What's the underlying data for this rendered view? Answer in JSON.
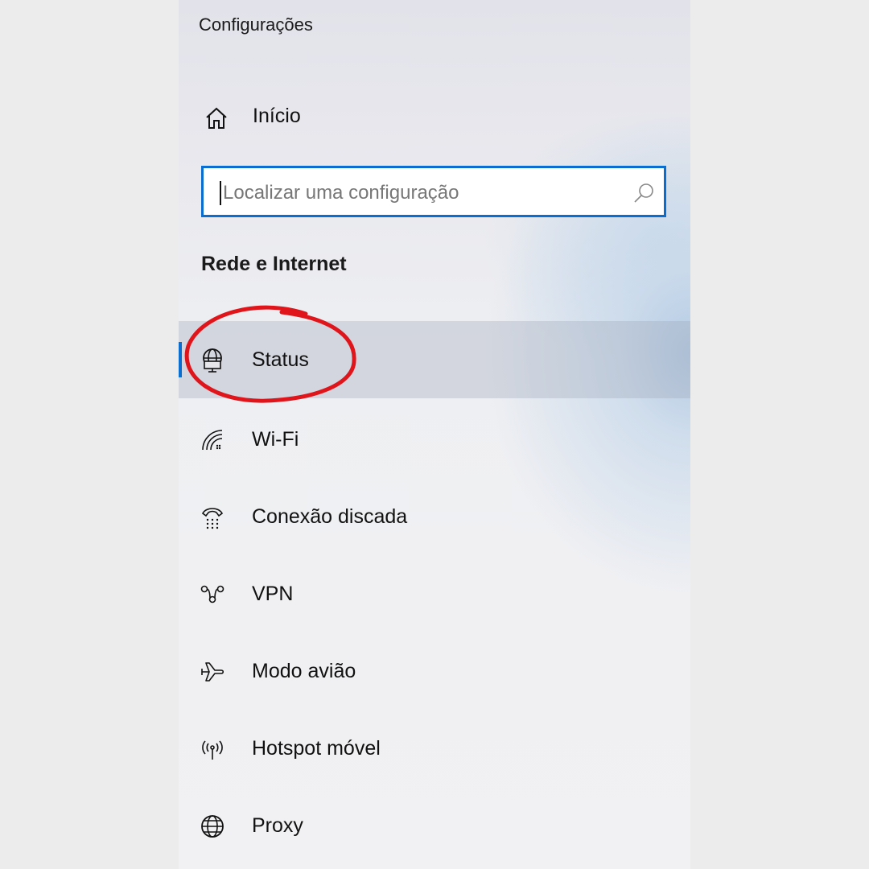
{
  "app": {
    "title": "Configurações"
  },
  "home": {
    "label": "Início",
    "icon": "home-icon"
  },
  "search": {
    "placeholder": "Localizar uma configuração",
    "value": "",
    "icon": "search-icon"
  },
  "section": {
    "title": "Rede e Internet"
  },
  "nav": {
    "items": [
      {
        "label": "Status",
        "icon": "globe-monitor-icon",
        "selected": true
      },
      {
        "label": "Wi-Fi",
        "icon": "wifi-icon",
        "selected": false
      },
      {
        "label": "Conexão discada",
        "icon": "dial-up-phone-icon",
        "selected": false
      },
      {
        "label": "VPN",
        "icon": "vpn-icon",
        "selected": false
      },
      {
        "label": "Modo avião",
        "icon": "airplane-icon",
        "selected": false
      },
      {
        "label": "Hotspot móvel",
        "icon": "hotspot-icon",
        "selected": false
      },
      {
        "label": "Proxy",
        "icon": "globe-icon",
        "selected": false
      }
    ]
  },
  "colors": {
    "accent": "#0a6ed1",
    "annotation": "#e0151b"
  }
}
